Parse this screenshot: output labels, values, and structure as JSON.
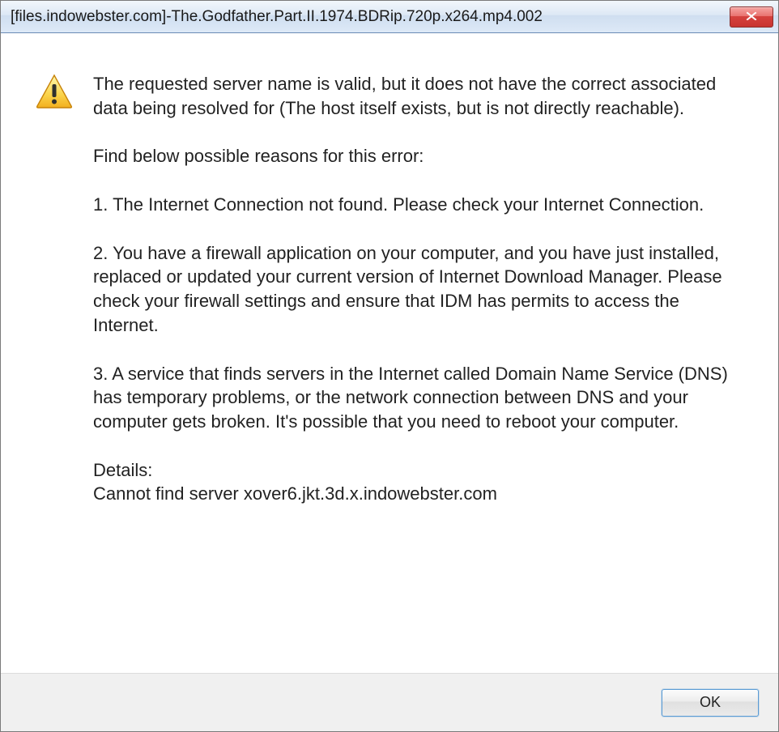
{
  "titlebar": {
    "title": "[files.indowebster.com]-The.Godfather.Part.II.1974.BDRip.720p.x264.mp4.002"
  },
  "icon": {
    "name": "warning-icon"
  },
  "message": {
    "p1": "The requested server name is valid, but it does not have the correct associated data being resolved for (The host itself exists, but is not directly reachable).",
    "p2": "Find below possible reasons for this error:",
    "p3": "1. The Internet Connection not found. Please check your Internet Connection.",
    "p4": "2. You have a firewall application on your computer, and you have just installed, replaced or updated your current version of Internet Download Manager. Please check your firewall settings and ensure that IDM has permits to access the Internet.",
    "p5": "3. A service that finds servers in the Internet called Domain Name Service (DNS) has temporary problems, or the network connection between DNS and your computer gets broken. It's possible that you need to reboot your computer.",
    "p6_label": "Details:",
    "p6_value": "Cannot find server xover6.jkt.3d.x.indowebster.com"
  },
  "buttons": {
    "ok": "OK"
  }
}
